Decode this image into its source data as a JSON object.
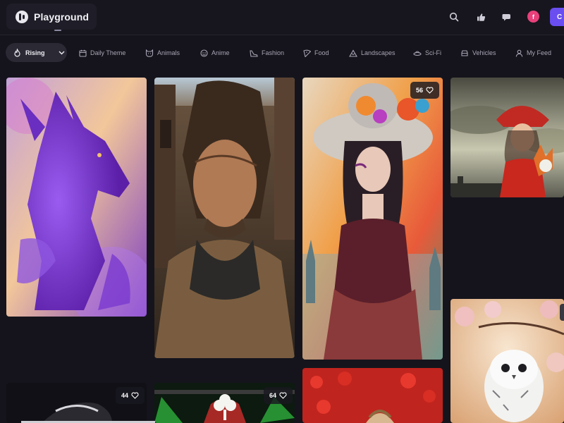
{
  "app": {
    "title": "Playground"
  },
  "header": {
    "avatar_initial": "f",
    "cta_label": "C",
    "icons": [
      "search-icon",
      "thumbs-up-icon",
      "chat-icon"
    ]
  },
  "nav": {
    "sort_label": "Rising",
    "items": [
      {
        "label": "Daily Theme",
        "icon": "calendar-icon"
      },
      {
        "label": "Animals",
        "icon": "cat-icon"
      },
      {
        "label": "Anime",
        "icon": "anime-face-icon"
      },
      {
        "label": "Fashion",
        "icon": "heel-icon"
      },
      {
        "label": "Food",
        "icon": "pizza-icon"
      },
      {
        "label": "Landscapes",
        "icon": "mountain-icon"
      },
      {
        "label": "Sci-Fi",
        "icon": "ufo-icon"
      },
      {
        "label": "Vehicles",
        "icon": "car-icon"
      },
      {
        "label": "My Feed",
        "icon": "user-icon"
      }
    ]
  },
  "feed": {
    "cards": [
      {
        "subject": "Purple dragon",
        "likes": null
      },
      {
        "subject": "Rugged cowboy portrait",
        "likes": null
      },
      {
        "subject": "Woman in flower hat",
        "likes": "56"
      },
      {
        "subject": "Girl in red hood with fox",
        "likes": null
      },
      {
        "subject": "Snowy owl with blossoms",
        "likes": null
      },
      {
        "subject": "Dark portrait",
        "likes": "44"
      },
      {
        "subject": "Stage with clover",
        "likes": "64"
      },
      {
        "subject": "Poppy field",
        "likes": null
      }
    ]
  },
  "colors": {
    "background": "#15141c",
    "accent": "#6a4ef0",
    "avatar": "#e8407a"
  }
}
